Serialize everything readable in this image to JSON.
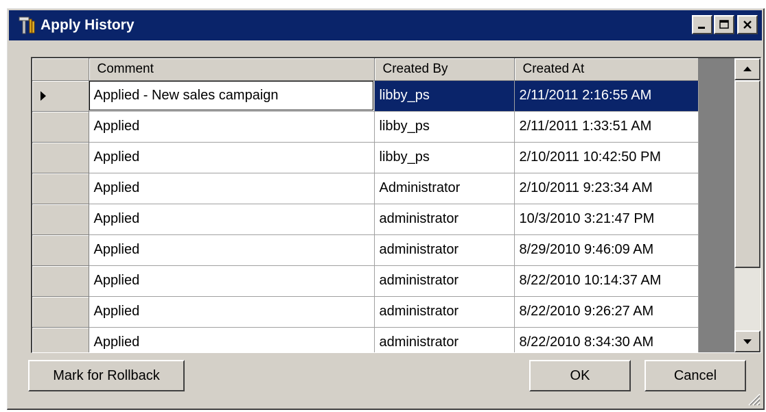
{
  "window": {
    "title": "Apply History",
    "app_icon": "tools-icon",
    "buttons": [
      "minimize-icon",
      "restore-icon",
      "close-icon"
    ]
  },
  "grid": {
    "columns": [
      "Comment",
      "Created By",
      "Created At"
    ],
    "selected_row_index": 0,
    "rows": [
      {
        "comment": "Applied - New sales campaign",
        "created_by": "libby_ps",
        "created_at": "2/11/2011 2:16:55 AM"
      },
      {
        "comment": "Applied",
        "created_by": "libby_ps",
        "created_at": "2/11/2011 1:33:51 AM"
      },
      {
        "comment": "Applied",
        "created_by": "libby_ps",
        "created_at": "2/10/2011 10:42:50 PM"
      },
      {
        "comment": "Applied",
        "created_by": "Administrator",
        "created_at": "2/10/2011 9:23:34 AM"
      },
      {
        "comment": "Applied",
        "created_by": "administrator",
        "created_at": "10/3/2010 3:21:47 PM"
      },
      {
        "comment": "Applied",
        "created_by": "administrator",
        "created_at": "8/29/2010 9:46:09 AM"
      },
      {
        "comment": "Applied",
        "created_by": "administrator",
        "created_at": "8/22/2010 10:14:37 AM"
      },
      {
        "comment": "Applied",
        "created_by": "administrator",
        "created_at": "8/22/2010 9:26:27 AM"
      },
      {
        "comment": "Applied",
        "created_by": "administrator",
        "created_at": "8/22/2010 8:34:30 AM"
      }
    ],
    "scrollbar": {
      "thumb_fraction": 0.75,
      "position_fraction": 0.0
    }
  },
  "actions": {
    "rollback_label": "Mark for Rollback",
    "ok_label": "OK",
    "cancel_label": "Cancel"
  },
  "colors": {
    "titlebar": "#0a246a",
    "selection": "#0a246a",
    "face": "#d4d0c8"
  }
}
